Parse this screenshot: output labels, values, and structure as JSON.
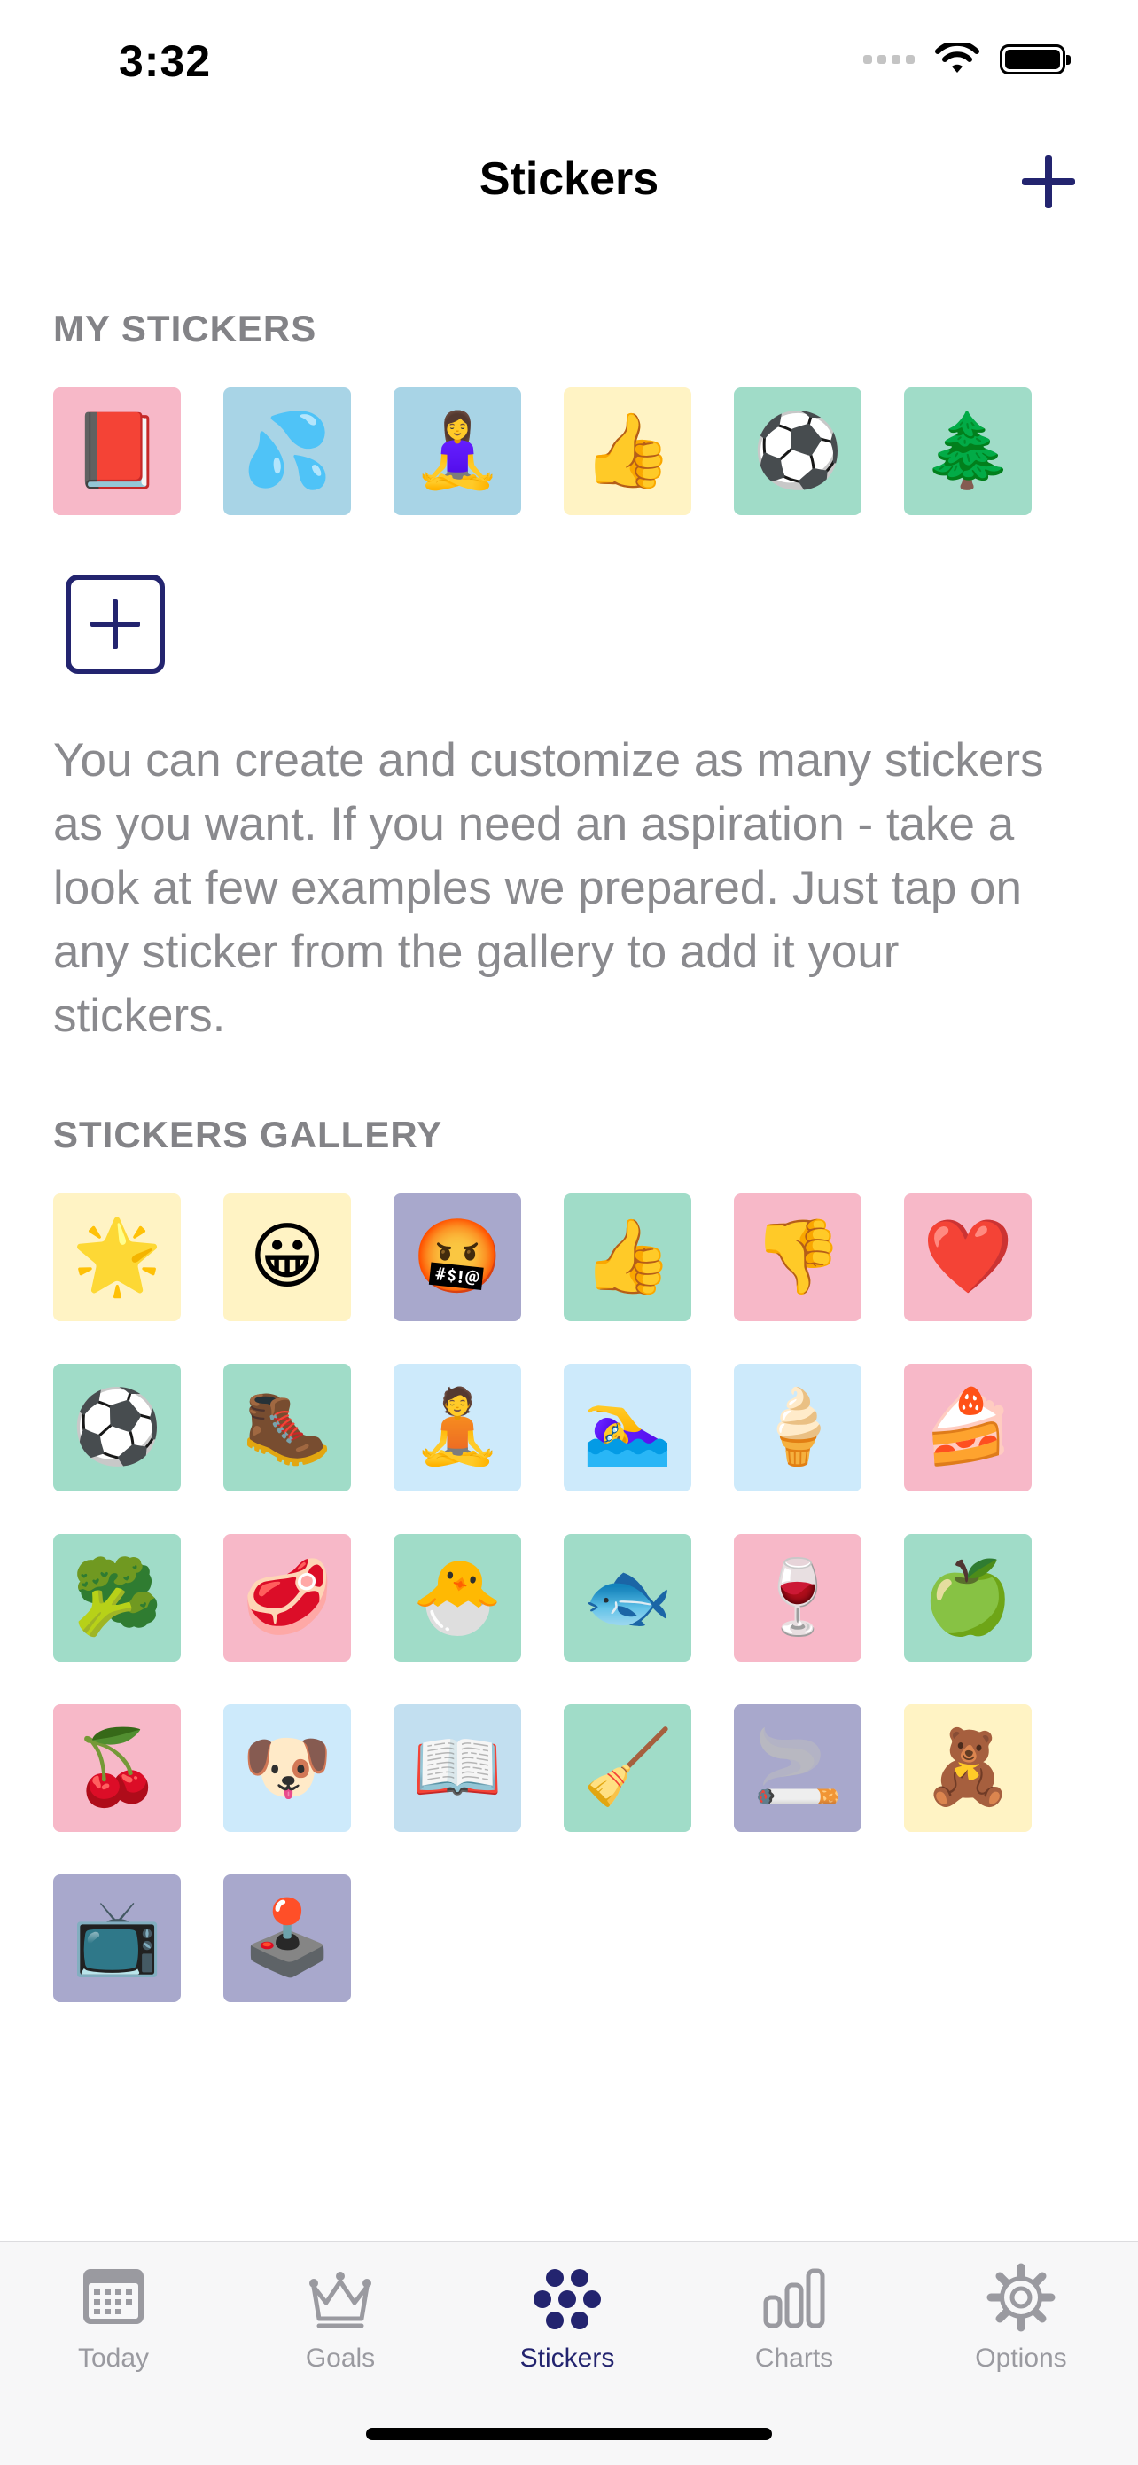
{
  "status_bar": {
    "time": "3:32"
  },
  "nav": {
    "title": "Stickers",
    "add_icon": "plus-icon"
  },
  "my_stickers": {
    "header": "MY STICKERS",
    "items": [
      {
        "emoji": "📕",
        "name": "closed-book",
        "color": "#f7b8c8"
      },
      {
        "emoji": "💦",
        "name": "sweat-droplets",
        "color": "#a8d4e6"
      },
      {
        "emoji": "🧘‍♀️",
        "name": "woman-in-lotus-position",
        "color": "#a8d4e6"
      },
      {
        "emoji": "👍",
        "name": "thumbs-up",
        "color": "#fff3c4"
      },
      {
        "emoji": "⚽",
        "name": "soccer-ball",
        "color": "#a0dcc8"
      },
      {
        "emoji": "🌲",
        "name": "evergreen-tree",
        "color": "#a0dcc8"
      }
    ]
  },
  "description": "You can create and customize as many stickers as you want. If you need an aspiration - take a look at few examples we prepared. Just tap on any sticker from the gallery to add it your stickers.",
  "gallery": {
    "header": "STICKERS GALLERY",
    "items": [
      {
        "emoji": "🌟",
        "name": "glowing-star",
        "color": "#fff3c4"
      },
      {
        "emoji": "😀",
        "name": "grinning-face",
        "color": "#fff3c4"
      },
      {
        "emoji": "🤬",
        "name": "face-with-symbols",
        "color": "#a8a8cc"
      },
      {
        "emoji": "👍",
        "name": "thumbs-up",
        "color": "#a0dcc8"
      },
      {
        "emoji": "👎",
        "name": "thumbs-down",
        "color": "#f7b8c8"
      },
      {
        "emoji": "❤️",
        "name": "red-heart",
        "color": "#f7b8c8"
      },
      {
        "emoji": "⚽",
        "name": "soccer-ball",
        "color": "#a0dcc8"
      },
      {
        "emoji": "🥾",
        "name": "hiking-boot",
        "color": "#a0dcc8"
      },
      {
        "emoji": "🧘",
        "name": "person-in-lotus-position",
        "color": "#cdeafb"
      },
      {
        "emoji": "🏊‍♀️",
        "name": "woman-swimming",
        "color": "#cdeafb"
      },
      {
        "emoji": "🍦",
        "name": "soft-ice-cream",
        "color": "#cdeafb"
      },
      {
        "emoji": "🍰",
        "name": "shortcake",
        "color": "#f7b8c8"
      },
      {
        "emoji": "🥦",
        "name": "broccoli",
        "color": "#a0dcc8"
      },
      {
        "emoji": "🥩",
        "name": "cut-of-meat",
        "color": "#f7b8c8"
      },
      {
        "emoji": "🐣",
        "name": "hatching-chick",
        "color": "#a0dcc8"
      },
      {
        "emoji": "🐟",
        "name": "fish",
        "color": "#a0dcc8"
      },
      {
        "emoji": "🍷",
        "name": "wine-glass",
        "color": "#f7b8c8"
      },
      {
        "emoji": "🍏",
        "name": "green-apple",
        "color": "#a0dcc8"
      },
      {
        "emoji": "🍒",
        "name": "cherries",
        "color": "#f7b8c8"
      },
      {
        "emoji": "🐶",
        "name": "dog-face",
        "color": "#cdeafb"
      },
      {
        "emoji": "📖",
        "name": "open-book",
        "color": "#c2dff0"
      },
      {
        "emoji": "🧹",
        "name": "broom",
        "color": "#a0dcc8"
      },
      {
        "emoji": "🚬",
        "name": "cigarette",
        "color": "#a8a8cc"
      },
      {
        "emoji": "🧸",
        "name": "teddy-bear",
        "color": "#fff3c4"
      },
      {
        "emoji": "📺",
        "name": "television",
        "color": "#a8a8cc"
      },
      {
        "emoji": "🕹️",
        "name": "joystick",
        "color": "#a8a8cc"
      }
    ]
  },
  "tabs": [
    {
      "label": "Today",
      "icon": "calendar-icon",
      "active": false
    },
    {
      "label": "Goals",
      "icon": "crown-icon",
      "active": false
    },
    {
      "label": "Stickers",
      "icon": "dots-cluster-icon",
      "active": true
    },
    {
      "label": "Charts",
      "icon": "bar-chart-icon",
      "active": false
    },
    {
      "label": "Options",
      "icon": "gear-icon",
      "active": false
    }
  ],
  "colors": {
    "accent": "#23246f",
    "inactive": "#9a9aa0",
    "section_header": "#838387"
  }
}
